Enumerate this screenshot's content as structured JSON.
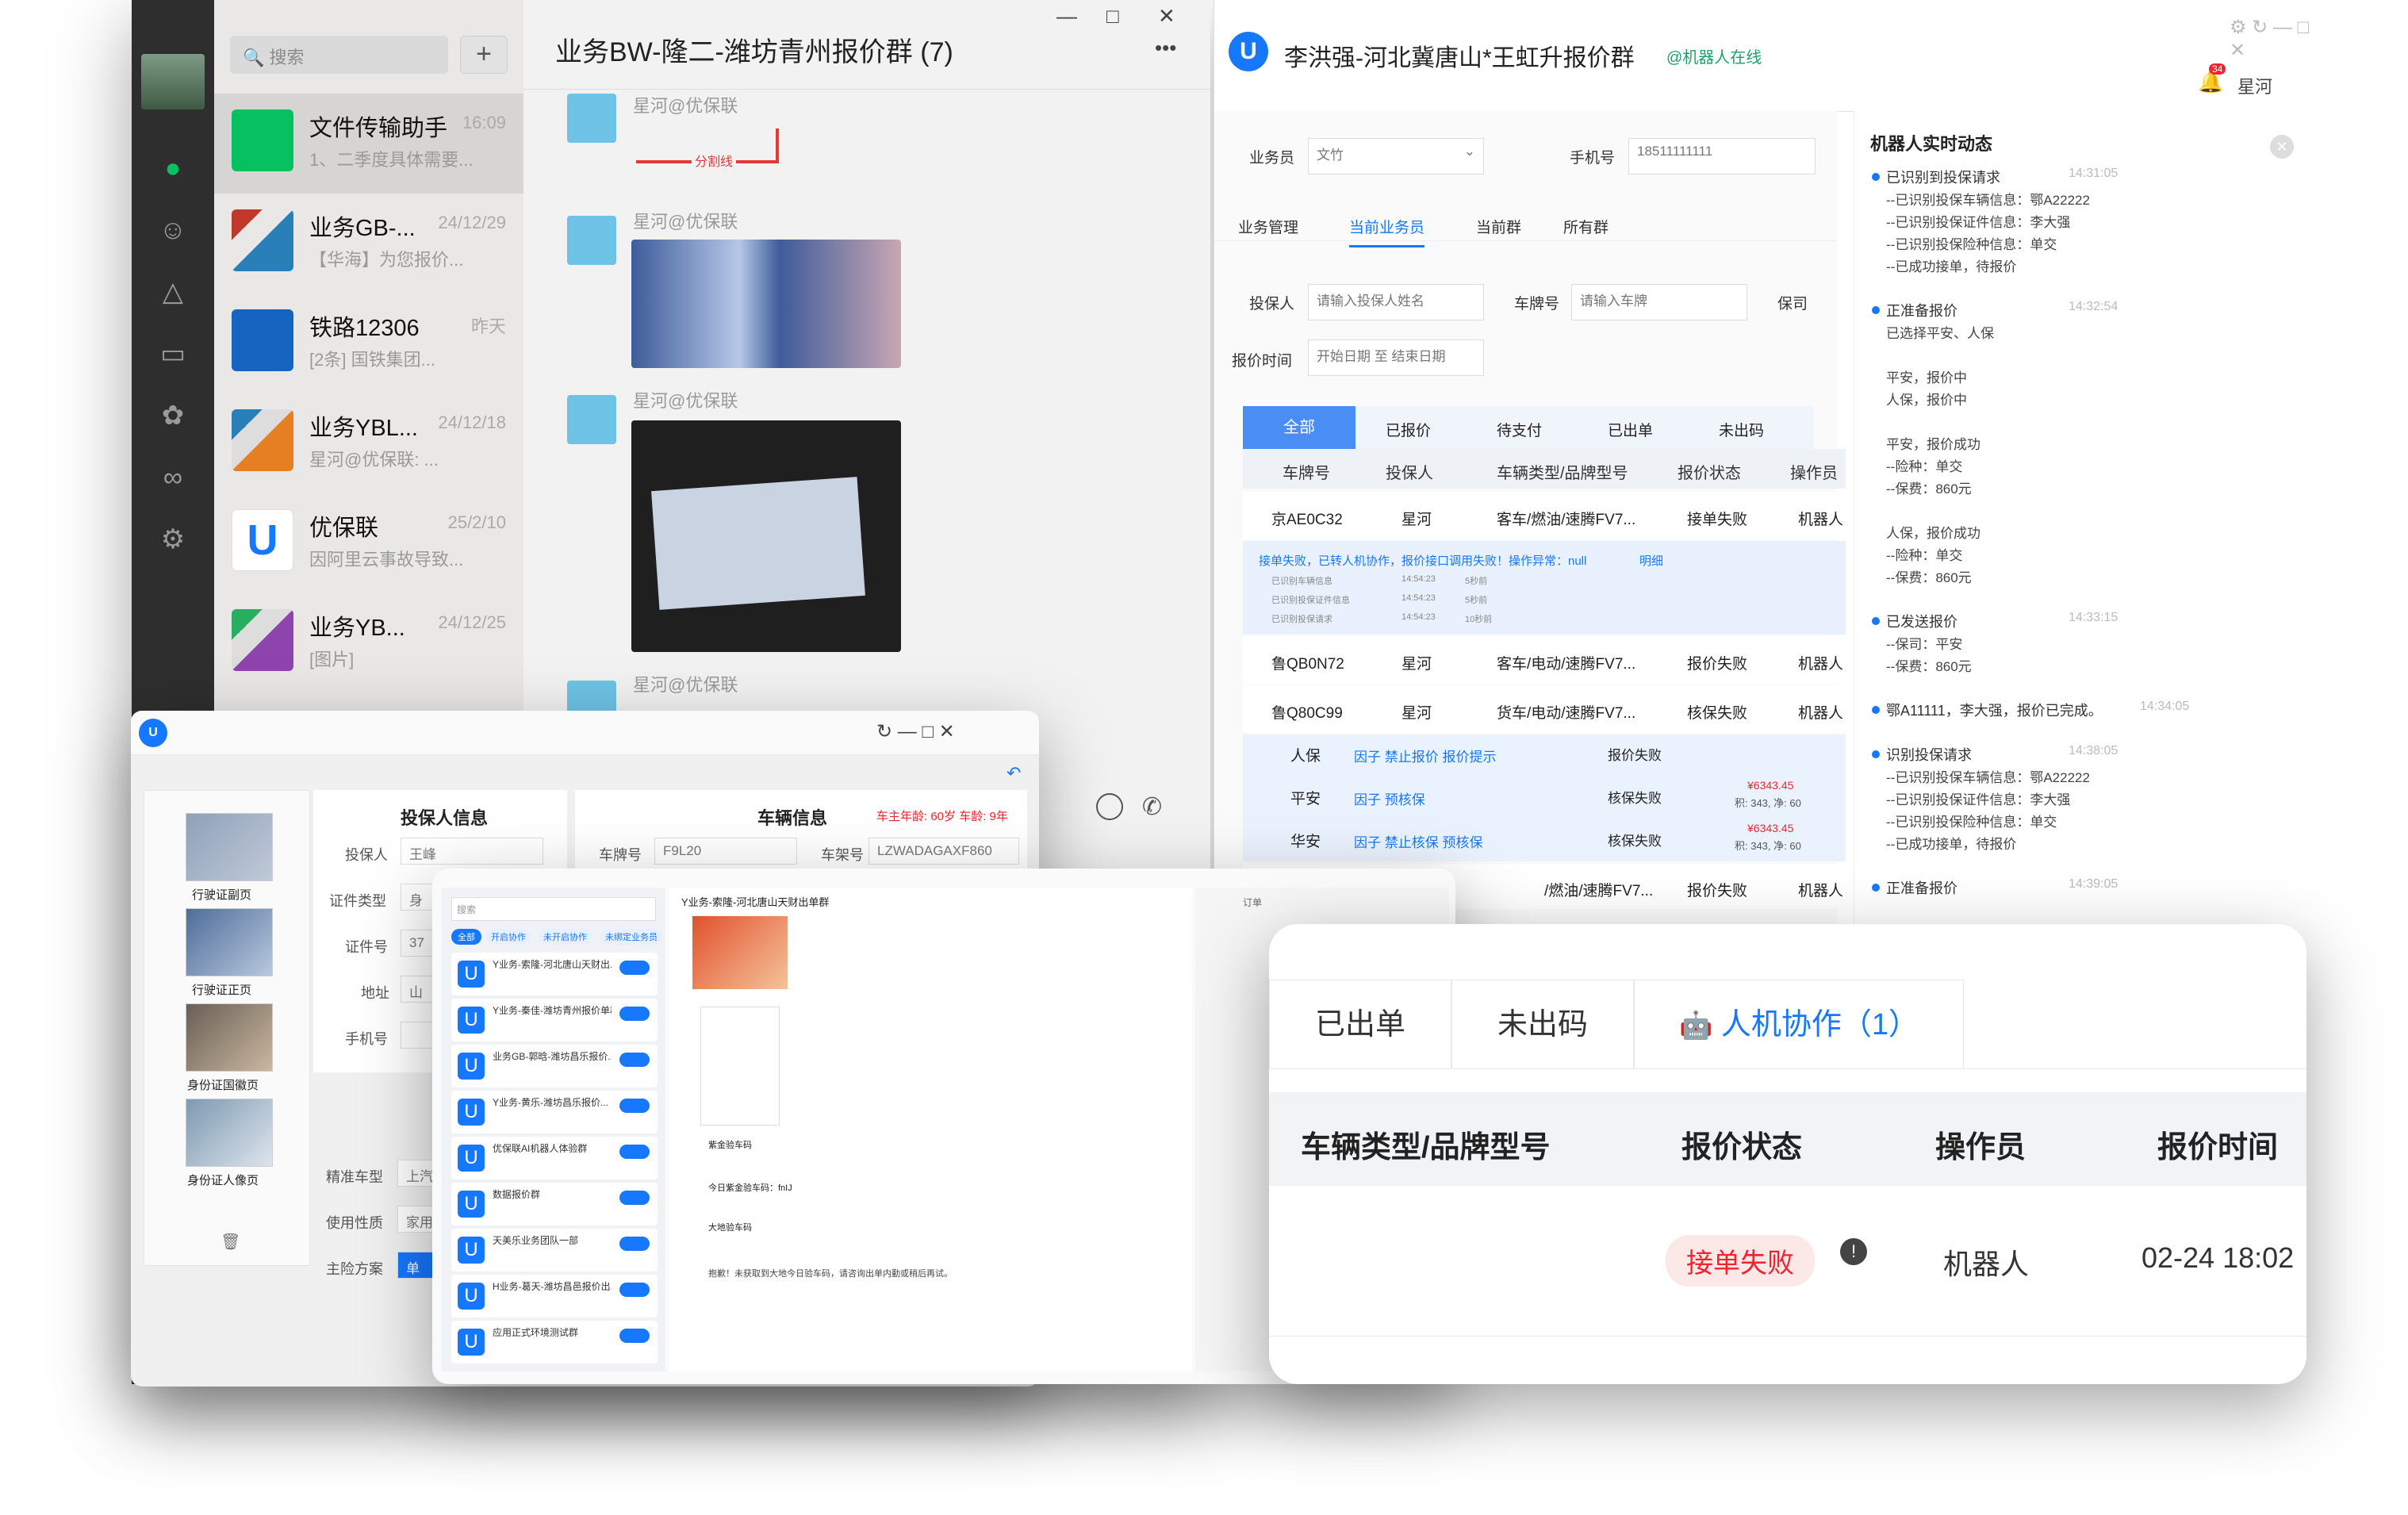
{
  "wechat": {
    "search_placeholder": "搜索",
    "conversations": [
      {
        "name": "文件传输助手",
        "time": "16:09",
        "preview": "1、二季度具体需要..."
      },
      {
        "name": "业务GB-...",
        "time": "24/12/29",
        "preview": "【华海】为您报价..."
      },
      {
        "name": "铁路12306",
        "time": "昨天",
        "preview": "[2条] 国铁集团..."
      },
      {
        "name": "业务YBL...",
        "time": "24/12/18",
        "preview": "星河@优保联: ..."
      },
      {
        "name": "优保联",
        "time": "25/2/10",
        "preview": "因阿里云事故导致..."
      },
      {
        "name": "业务YB...",
        "time": "24/12/25",
        "preview": "[图片]"
      }
    ],
    "chat_title": "业务BW-隆二-潍坊青州报价群 (7)",
    "sender": "星河@优保联",
    "divider_label": "分割线",
    "more": "•••"
  },
  "app": {
    "title": "李洪强-河北冀唐山*王虹升报价群",
    "robot_status": "@机器人在线",
    "user": "星河",
    "notif_count": "34",
    "salesman_label": "业务员",
    "salesman_value": "文竹",
    "phone_label": "手机号",
    "phone_value": "18511111111",
    "nav_tabs": [
      "业务管理",
      "当前业务员",
      "当前群",
      "所有群"
    ],
    "insured_label": "投保人",
    "insured_ph": "请输入投保人姓名",
    "plate_label": "车牌号",
    "plate_ph": "请输入车牌",
    "insurer_label": "保司",
    "quote_time_label": "报价时间",
    "date_ph": "开始日期  至  结束日期",
    "status_tabs": [
      "全部",
      "已报价",
      "待支付",
      "已出单",
      "未出码"
    ],
    "table_headers": [
      "车牌号",
      "投保人",
      "车辆类型/品牌型号",
      "报价状态",
      "操作员"
    ],
    "rows": [
      {
        "plate": "京AE0C32",
        "insured": "星河",
        "vehicle": "客车/燃油/速腾FV7...",
        "status": "接单失败",
        "op": "机器人"
      },
      {
        "plate": "鲁QB0N72",
        "insured": "星河",
        "vehicle": "客车/电动/速腾FV7...",
        "status": "报价失败",
        "op": "机器人"
      },
      {
        "plate": "鲁Q80C99",
        "insured": "星河",
        "vehicle": "货车/电动/速腾FV7...",
        "status": "核保失败",
        "op": "机器人"
      }
    ],
    "row_error": "接单失败，已转人机协作，报价接口调用失败！操作异常：null",
    "row_error_link": "明细",
    "row_sub": [
      {
        "label": "已识别车辆信息",
        "time": "14:54:23",
        "dur": "5秒前"
      },
      {
        "label": "已识别投保证件信息",
        "time": "14:54:23",
        "dur": "5秒前"
      },
      {
        "label": "已识别投保请求",
        "time": "14:54:23",
        "dur": "10秒前"
      }
    ],
    "insurers": [
      {
        "name": "人保",
        "links": "因子  禁止报价  报价提示",
        "status": "报价失败"
      },
      {
        "name": "平安",
        "links": "因子  预核保",
        "status": "核保失败",
        "price": "¥6343.45",
        "extra": "积: 343, 净: 60"
      },
      {
        "name": "华安",
        "links": "因子  禁止核保  预核保",
        "status": "核保失败",
        "price": "¥6343.45",
        "extra": "积: 343, 净: 60"
      }
    ],
    "last_row": {
      "vehicle": "/燃油/速腾FV7...",
      "status": "报价失败",
      "op": "机器人"
    },
    "feed_title": "机器人实时动态",
    "feed": [
      {
        "head": "已识别到投保请求",
        "time": "14:31:05",
        "lines": [
          "--已识别投保车辆信息：鄂A22222",
          "--已识别投保证件信息：李大强",
          "--已识别投保险种信息：单交",
          "--已成功接单，待报价"
        ]
      },
      {
        "head": "正准备报价",
        "time": "14:32:54",
        "lines": [
          "已选择平安、人保",
          "",
          "平安，报价中",
          "人保，报价中",
          "",
          "平安，报价成功",
          "--险种：单交",
          "--保费：860元",
          "",
          "人保，报价成功",
          "--险种：单交",
          "--保费：860元"
        ]
      },
      {
        "head": "已发送报价",
        "time": "14:33:15",
        "lines": [
          "--保司：平安",
          "--保费：860元"
        ]
      },
      {
        "head": "鄂A11111，李大强，报价已完成。",
        "time": "14:34:05",
        "lines": []
      },
      {
        "head": "识别投保请求",
        "time": "14:38:05",
        "lines": [
          "--已识别投保车辆信息：鄂A22222",
          "--已识别投保证件信息：李大强",
          "--已识别投保险种信息：单交",
          "--已成功接单，待报价"
        ]
      },
      {
        "head": "正准备报价",
        "time": "14:39:05",
        "lines": []
      }
    ]
  },
  "ins": {
    "thumbs": [
      "行驶证副页",
      "行驶证正页",
      "身份证国徽页",
      "身份证人像页"
    ],
    "section1": "投保人信息",
    "section2": "车辆信息",
    "warn": "车主年龄: 60岁  车龄: 9年",
    "fields": [
      [
        "投保人",
        "王峰"
      ],
      [
        "证件类型",
        "身"
      ],
      [
        "证件号",
        "37"
      ],
      [
        "地址",
        "山"
      ],
      [
        "手机号",
        ""
      ]
    ],
    "car_fields": [
      [
        "车牌号",
        "F9L20"
      ],
      [
        "车架号",
        "LZWADAGAXF860"
      ]
    ],
    "bottom_fields": [
      [
        "精准车型",
        "上汽"
      ],
      [
        "使用性质",
        "家用"
      ],
      [
        "主险方案",
        "单"
      ]
    ]
  },
  "crm": {
    "search": "搜索",
    "filters": [
      "全部",
      "开启协作",
      "未开启协作",
      "未绑定业务员"
    ],
    "group_title": "Y业务-索隆-河北唐山天财出单群",
    "items": [
      "Y业务-索隆-河北唐山天财出...",
      "Y业务-秦佳-潍坊青州报价单群",
      "业务GB-郭晗-潍坊昌乐报价...",
      "Y业务-黄乐-潍坊昌乐报价...",
      "优保联AI机器人体验群",
      "数据报价群",
      "天美乐业务团队一部",
      "H业务-葛天-潍坊昌邑报价出...",
      "应用正式环境测试群"
    ],
    "messages": [
      "紫金验车码",
      "今日紫金验车码：fnIJ",
      "大地验车码",
      "抱歉！未获取到大地今日验车码，请咨询出单内勤或稍后再试。"
    ],
    "right_label": "订单"
  },
  "card": {
    "tabs": [
      "已出单",
      "未出码",
      "人机协作（1）"
    ],
    "headers": [
      "车辆类型/品牌型号",
      "报价状态",
      "操作员",
      "报价时间"
    ],
    "row": {
      "status": "接单失败",
      "op": "机器人",
      "time": "02-24 18:02"
    }
  },
  "colors": {
    "accent": "#1677ff",
    "wechat_green": "#07c160",
    "danger": "#f5222d"
  }
}
